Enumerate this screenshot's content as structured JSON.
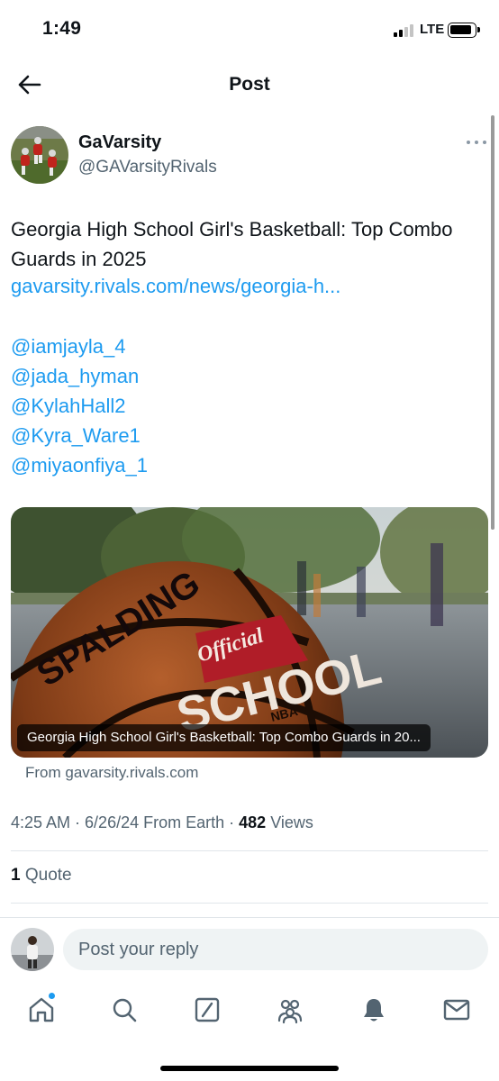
{
  "status_bar": {
    "time": "1:49",
    "network": "LTE"
  },
  "header": {
    "title": "Post"
  },
  "author": {
    "name": "GaVarsity",
    "handle": "@GAVarsityRivals"
  },
  "post": {
    "text": "Georgia High School Girl's Basketball: Top Combo Guards in 2025",
    "link": "gavarsity.rivals.com/news/georgia-h...",
    "mentions": [
      "@iamjayla_4",
      "@jada_hyman",
      "@KylahHall2",
      "@Kyra_Ware1",
      "@miyaonfiya_1"
    ]
  },
  "card": {
    "caption": "Georgia High School Girl's Basketball: Top Combo Guards in 20...",
    "source": "From gavarsity.rivals.com",
    "image_text": {
      "brand": "SPALDING",
      "label_a": "Official",
      "label_b": "SCHOOL",
      "label_c": "NBA"
    }
  },
  "meta": {
    "time": "4:25 AM",
    "date": "6/26/24",
    "via": "From Earth",
    "views_count": "482",
    "views_label": "Views"
  },
  "engagement": {
    "quote_count": "1",
    "quote_label": "Quote"
  },
  "reply": {
    "placeholder": "Post your reply"
  },
  "tab_bar": {
    "icons": [
      "home-icon",
      "search-icon",
      "grok-icon",
      "communities-icon",
      "notifications-icon",
      "messages-icon"
    ]
  },
  "colors": {
    "accent": "#1d9bf0",
    "text": "#0f1419",
    "muted": "#536471",
    "input_bg": "#eff3f4"
  }
}
